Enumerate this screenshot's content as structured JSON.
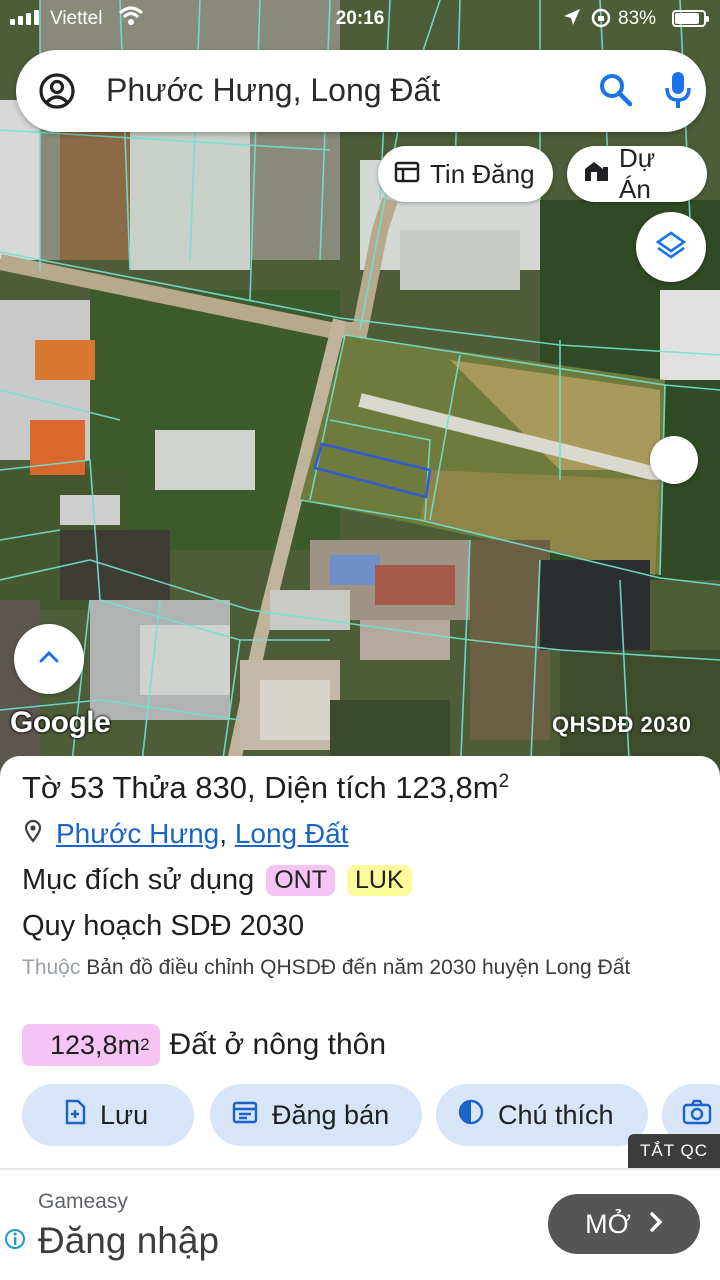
{
  "status_bar": {
    "carrier": "Viettel",
    "time": "20:16",
    "battery": "83%"
  },
  "search": {
    "query": "Phước Hưng, Long Đất"
  },
  "map_chips": {
    "listings": "Tin Đăng",
    "projects": "Dự Án"
  },
  "map": {
    "attribution": "Google",
    "layer_label": "QHSDĐ 2030"
  },
  "parcel": {
    "sheet_label": "Tờ",
    "sheet_no": "53",
    "parcel_label": "Thửa",
    "parcel_no": "830",
    "area_label": "Diện tích",
    "area_value": "123,8m",
    "area_unit_sup": "2",
    "location_ward": "Phước Hưng",
    "location_district": "Long Đất",
    "usage_label": "Mục đích sử dụng",
    "usage_tags": [
      "ONT",
      "LUK"
    ],
    "plan_title": "Quy hoạch SDĐ 2030",
    "plan_source_prefix": "Thuộc",
    "plan_source": "Bản đồ điều chỉnh QHSDĐ đến năm 2030 huyện Long Đất",
    "zone_area": "123,8m",
    "zone_area_sup": "2",
    "zone_desc": "Đất ở nông thôn"
  },
  "actions": {
    "save": "Lưu",
    "sell": "Đăng bán",
    "legend": "Chú thích"
  },
  "ad": {
    "close": "TẮT QC",
    "brand": "Gameasy",
    "title": "Đăng nhập",
    "cta": "MỞ"
  },
  "colors": {
    "parcel_outline": "#6fe3d2",
    "selected_parcel": "#2f5bd8",
    "accent_blue": "#1a73e8",
    "action_bg": "#d7e5f7",
    "ont_tag": "#f6c3f5",
    "luk_tag": "#fbfb9c"
  },
  "icons": [
    "account-icon",
    "search-icon",
    "mic-icon",
    "listing-icon",
    "project-icon",
    "layers-icon",
    "chevron-up-icon",
    "pin-icon",
    "add-doc-icon",
    "calendar-icon",
    "contrast-icon",
    "camera-icon",
    "info-icon",
    "chevron-right-icon"
  ]
}
